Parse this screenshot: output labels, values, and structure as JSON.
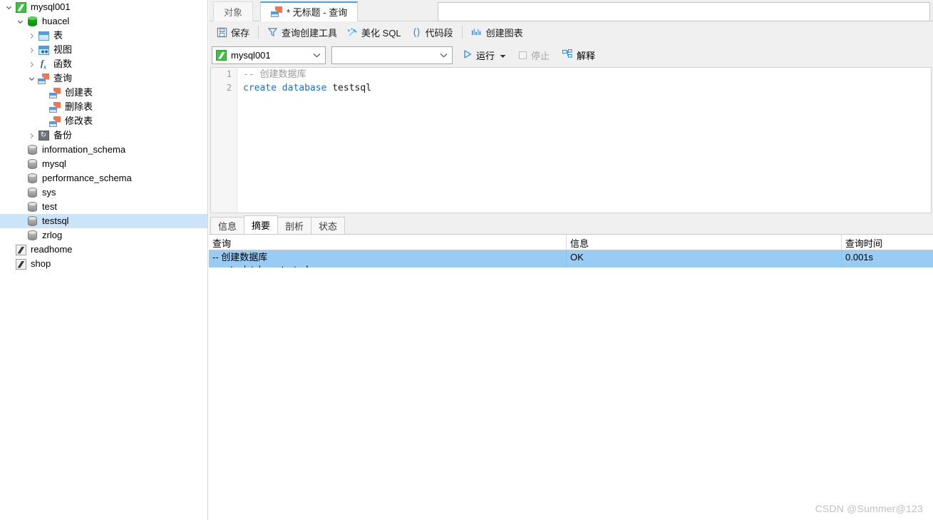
{
  "sidebar": {
    "tree": [
      {
        "label": "mysql001",
        "indent": 0,
        "twisty": "down",
        "icon": "connection-green-icon",
        "selected": false
      },
      {
        "label": "huacel",
        "indent": 1,
        "twisty": "down",
        "icon": "database-green-icon",
        "selected": false
      },
      {
        "label": "表",
        "indent": 2,
        "twisty": "right",
        "icon": "table-icon",
        "selected": false
      },
      {
        "label": "视图",
        "indent": 2,
        "twisty": "right",
        "icon": "view-icon",
        "selected": false
      },
      {
        "label": "函数",
        "indent": 2,
        "twisty": "right",
        "icon": "function-icon",
        "selected": false
      },
      {
        "label": "查询",
        "indent": 2,
        "twisty": "down",
        "icon": "query-icon",
        "selected": false
      },
      {
        "label": "创建表",
        "indent": 3,
        "twisty": "none",
        "icon": "query-icon",
        "selected": false
      },
      {
        "label": "删除表",
        "indent": 3,
        "twisty": "none",
        "icon": "query-icon",
        "selected": false
      },
      {
        "label": "修改表",
        "indent": 3,
        "twisty": "none",
        "icon": "query-icon",
        "selected": false
      },
      {
        "label": "备份",
        "indent": 2,
        "twisty": "right",
        "icon": "backup-icon",
        "selected": false
      },
      {
        "label": "information_schema",
        "indent": 1,
        "twisty": "none",
        "icon": "database-gray-icon",
        "selected": false
      },
      {
        "label": "mysql",
        "indent": 1,
        "twisty": "none",
        "icon": "database-gray-icon",
        "selected": false
      },
      {
        "label": "performance_schema",
        "indent": 1,
        "twisty": "none",
        "icon": "database-gray-icon",
        "selected": false
      },
      {
        "label": "sys",
        "indent": 1,
        "twisty": "none",
        "icon": "database-gray-icon",
        "selected": false
      },
      {
        "label": "test",
        "indent": 1,
        "twisty": "none",
        "icon": "database-gray-icon",
        "selected": false
      },
      {
        "label": "testsql",
        "indent": 1,
        "twisty": "none",
        "icon": "database-gray-icon",
        "selected": true
      },
      {
        "label": "zrlog",
        "indent": 1,
        "twisty": "none",
        "icon": "database-gray-icon",
        "selected": false
      },
      {
        "label": "readhome",
        "indent": 0,
        "twisty": "none",
        "icon": "connection-gray-icon",
        "selected": false
      },
      {
        "label": "shop",
        "indent": 0,
        "twisty": "none",
        "icon": "connection-gray-icon",
        "selected": false
      }
    ]
  },
  "tabstrip": {
    "object_tab": "对象",
    "query_tab": "* 无标题 - 查询",
    "query_tab_icon": "query-icon",
    "filter_value": "",
    "filter_placeholder": ""
  },
  "toolbar": {
    "save": "保存",
    "query_builder": "查询创建工具",
    "beautify_sql": "美化 SQL",
    "snippet": "代码段",
    "create_chart": "创建图表"
  },
  "toolbar2": {
    "connection_value": "mysql001",
    "connection_icon": "connection-green-icon",
    "database_value": "",
    "run": "运行",
    "stop": "停止",
    "explain": "解释"
  },
  "editor": {
    "lines": [
      {
        "num": "1",
        "comment": "-- 创建数据库",
        "keywords": "",
        "ident": ""
      },
      {
        "num": "2",
        "comment": "",
        "keywords": "create database",
        "ident": " testsql"
      }
    ],
    "line_numbers": [
      "1",
      "2"
    ],
    "full_text": "-- 创建数据库\ncreate database testsql"
  },
  "results": {
    "tabs": [
      {
        "label": "信息",
        "active": false
      },
      {
        "label": "摘要",
        "active": true
      },
      {
        "label": "剖析",
        "active": false
      },
      {
        "label": "状态",
        "active": false
      }
    ],
    "columns": [
      "查询",
      "信息",
      "查询时间"
    ],
    "rows": [
      {
        "query": "-- 创建数据库\ncreate database testsql",
        "info": "OK",
        "time": "0.001s",
        "selected": true
      }
    ]
  },
  "watermark": "CSDN @Summer@123",
  "colors": {
    "accent": "#4aa3e8",
    "selection": "#cce4f7",
    "row_selection": "#99ccf5",
    "chrome": "#f0f0f0",
    "keyword": "#1a6fd6",
    "comment": "#9b9b9b",
    "connection_green": "#3fc13f",
    "watermark": "#c2c2c2"
  }
}
